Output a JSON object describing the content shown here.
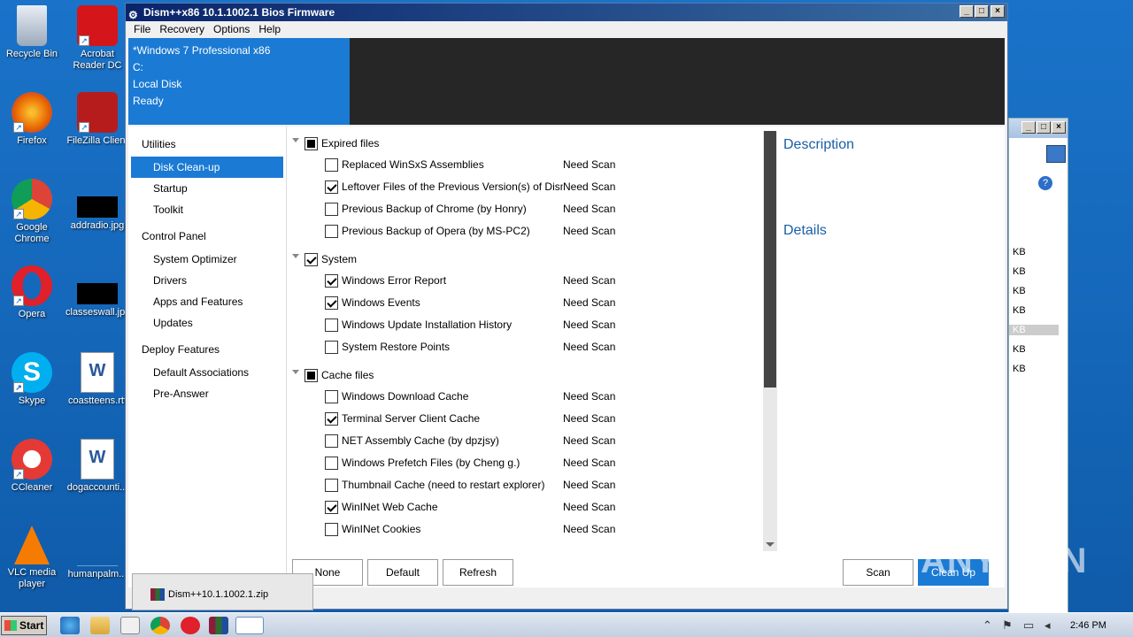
{
  "desktop": {
    "icons": [
      {
        "label": "Recycle Bin"
      },
      {
        "label": "Acrobat Reader DC"
      },
      {
        "label": "Firefox"
      },
      {
        "label": "FileZilla Client"
      },
      {
        "label": "Google Chrome"
      },
      {
        "label": "addradio.jpg"
      },
      {
        "label": "Opera"
      },
      {
        "label": "classeswall.jpg"
      },
      {
        "label": "Skype"
      },
      {
        "label": "coastteens.rtf"
      },
      {
        "label": "CCleaner"
      },
      {
        "label": "dogaccounti..."
      },
      {
        "label": "VLC media player"
      },
      {
        "label": "humanpalm..."
      }
    ]
  },
  "bg_window": {
    "sizes": [
      "KB",
      "KB",
      "KB",
      "KB",
      "KB",
      "KB",
      "KB"
    ]
  },
  "window": {
    "title": "Dism++x86 10.1.1002.1 Bios Firmware",
    "menu": [
      "File",
      "Recovery",
      "Options",
      "Help"
    ],
    "header": {
      "os": "*Windows 7 Professional x86",
      "drive": "C:",
      "disk": "Local Disk",
      "status": "Ready"
    },
    "nav": {
      "utilities": "Utilities",
      "disk_cleanup": "Disk Clean-up",
      "startup": "Startup",
      "toolkit": "Toolkit",
      "control_panel": "Control Panel",
      "system_optimizer": "System Optimizer",
      "drivers": "Drivers",
      "apps_features": "Apps and Features",
      "updates": "Updates",
      "deploy_features": "Deploy Features",
      "default_assoc": "Default Associations",
      "pre_answer": "Pre-Answer"
    },
    "groups": [
      {
        "label": "Expired files",
        "state": "partial",
        "items": [
          {
            "label": "Replaced WinSxS Assemblies",
            "status": "Need Scan",
            "checked": false
          },
          {
            "label": "Leftover Files of the Previous Version(s) of Dism",
            "status": "Need Scan",
            "checked": true
          },
          {
            "label": "Previous Backup of Chrome (by Honry)",
            "status": "Need Scan",
            "checked": false
          },
          {
            "label": "Previous Backup of Opera (by MS-PC2)",
            "status": "Need Scan",
            "checked": false
          }
        ]
      },
      {
        "label": "System",
        "state": "checked",
        "items": [
          {
            "label": "Windows Error Report",
            "status": "Need Scan",
            "checked": true
          },
          {
            "label": "Windows Events",
            "status": "Need Scan",
            "checked": true
          },
          {
            "label": "Windows Update Installation History",
            "status": "Need Scan",
            "checked": false
          },
          {
            "label": "System Restore Points",
            "status": "Need Scan",
            "checked": false
          }
        ]
      },
      {
        "label": "Cache files",
        "state": "partial",
        "items": [
          {
            "label": "Windows Download Cache",
            "status": "Need Scan",
            "checked": false
          },
          {
            "label": "Terminal Server Client Cache",
            "status": "Need Scan",
            "checked": true
          },
          {
            "label": "NET Assembly Cache (by dpzjsy)",
            "status": "Need Scan",
            "checked": false
          },
          {
            "label": "Windows Prefetch Files (by Cheng g.)",
            "status": "Need Scan",
            "checked": false
          },
          {
            "label": "Thumbnail Cache (need to restart explorer)",
            "status": "Need Scan",
            "checked": false
          },
          {
            "label": "WinINet Web Cache",
            "status": "Need Scan",
            "checked": true
          },
          {
            "label": "WinINet Cookies",
            "status": "Need Scan",
            "checked": false
          }
        ]
      }
    ],
    "description_label": "Description",
    "details_label": "Details",
    "buttons": {
      "none": "None",
      "default": "Default",
      "refresh": "Refresh",
      "scan": "Scan",
      "cleanup": "Clean Up"
    }
  },
  "download": {
    "file": "Dism++10.1.1002.1.zip"
  },
  "taskbar": {
    "start": "Start",
    "time": "2:46 PM"
  },
  "watermark": "ANY RUN"
}
